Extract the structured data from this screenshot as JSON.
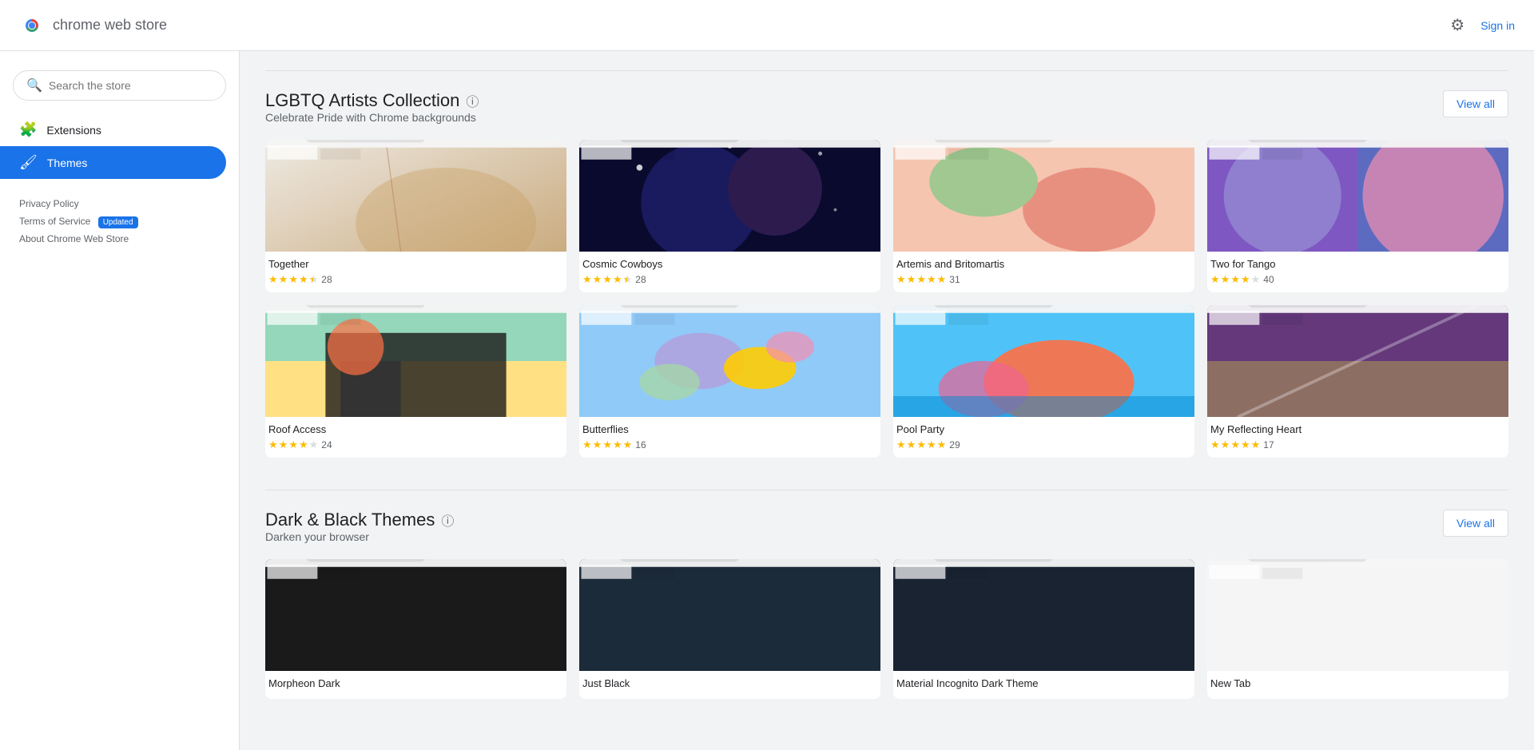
{
  "header": {
    "title": "chrome web store",
    "sign_in": "Sign in"
  },
  "search": {
    "placeholder": "Search the store"
  },
  "nav": {
    "extensions": "Extensions",
    "themes": "Themes"
  },
  "sidebar_links": [
    {
      "label": "Privacy Policy",
      "badge": null
    },
    {
      "label": "Terms of Service",
      "badge": "Updated"
    },
    {
      "label": "About Chrome Web Store",
      "badge": null
    }
  ],
  "lgbtq_section": {
    "title": "LGBTQ Artists Collection",
    "subtitle": "Celebrate Pride with Chrome backgrounds",
    "view_all": "View all"
  },
  "lgbtq_themes": [
    {
      "name": "Together",
      "rating": 4.5,
      "count": 28,
      "style": "together"
    },
    {
      "name": "Cosmic Cowboys",
      "rating": 4.5,
      "count": 28,
      "style": "cosmic"
    },
    {
      "name": "Artemis and Britomartis",
      "rating": 5.0,
      "count": 31,
      "style": "artemis"
    },
    {
      "name": "Two for Tango",
      "rating": 4.0,
      "count": 40,
      "style": "tango"
    },
    {
      "name": "Roof Access",
      "rating": 4.0,
      "count": 24,
      "style": "roof"
    },
    {
      "name": "Butterflies",
      "rating": 5.0,
      "count": 16,
      "style": "butterflies"
    },
    {
      "name": "Pool Party",
      "rating": 5.0,
      "count": 29,
      "style": "pool"
    },
    {
      "name": "My Reflecting Heart",
      "rating": 5.0,
      "count": 17,
      "style": "heart"
    }
  ],
  "dark_section": {
    "title": "Dark & Black Themes",
    "subtitle": "Darken your browser",
    "view_all": "View all"
  },
  "dark_themes": [
    {
      "name": "Morpheon Dark",
      "style": "dark1"
    },
    {
      "name": "Just Black",
      "style": "dark2"
    },
    {
      "name": "Material Incognito Dark Theme",
      "style": "dark3"
    },
    {
      "name": "New Tab",
      "style": "dark4"
    }
  ]
}
